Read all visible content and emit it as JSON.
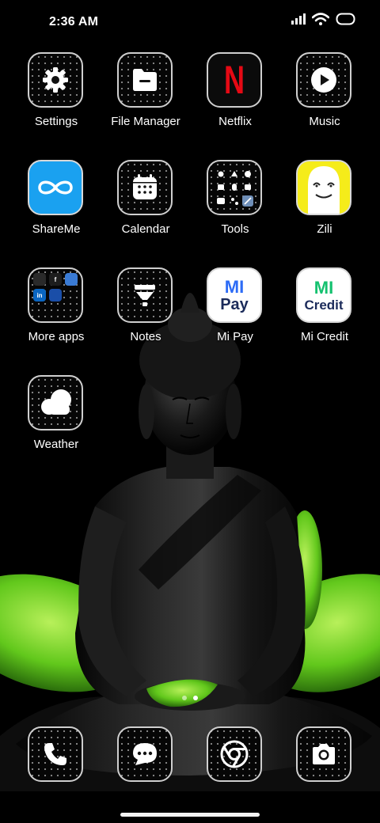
{
  "status_bar": {
    "time": "2:36 AM",
    "icons": [
      "signal-icon",
      "wifi-icon",
      "battery-icon"
    ]
  },
  "apps": [
    {
      "label": "Settings",
      "icon": "gear-icon"
    },
    {
      "label": "File Manager",
      "icon": "folder-icon"
    },
    {
      "label": "Netflix",
      "icon": "netflix-logo-icon"
    },
    {
      "label": "Music",
      "icon": "play-icon"
    },
    {
      "label": "ShareMe",
      "icon": "infinity-icon"
    },
    {
      "label": "Calendar",
      "icon": "calendar-icon"
    },
    {
      "label": "Tools",
      "icon": "tools-grid-icon"
    },
    {
      "label": "Zili",
      "icon": "zili-face-icon"
    },
    {
      "label": "More apps",
      "icon": "app-folder-icon"
    },
    {
      "label": "Notes",
      "icon": "funnel-icon"
    },
    {
      "label": "Mi Pay",
      "icon": "mi-pay-logo"
    },
    {
      "label": "Mi Credit",
      "icon": "mi-credit-logo"
    },
    {
      "label": "Weather",
      "icon": "cloud-icon"
    }
  ],
  "logo_text": {
    "netflix": "N",
    "mi": "MI",
    "pay": "Pay",
    "credit": "Credit",
    "folder_apps": [
      "",
      "",
      "f",
      "in",
      "",
      "",
      "",
      "",
      ""
    ]
  },
  "page_indicator": {
    "count": 2,
    "active": 2
  },
  "dock": [
    {
      "icon": "phone-icon"
    },
    {
      "icon": "messages-icon"
    },
    {
      "icon": "chrome-icon"
    },
    {
      "icon": "camera-icon"
    }
  ],
  "colors": {
    "netflix_red": "#e50914",
    "shareme_blue": "#1aa1f0",
    "zili_yellow": "#f5ec1a",
    "mi_green": "#14c16f",
    "mi_blue": "#2d6cf6",
    "mi_text": "#1b2b5a",
    "leaf_green": "#6ed21f"
  }
}
